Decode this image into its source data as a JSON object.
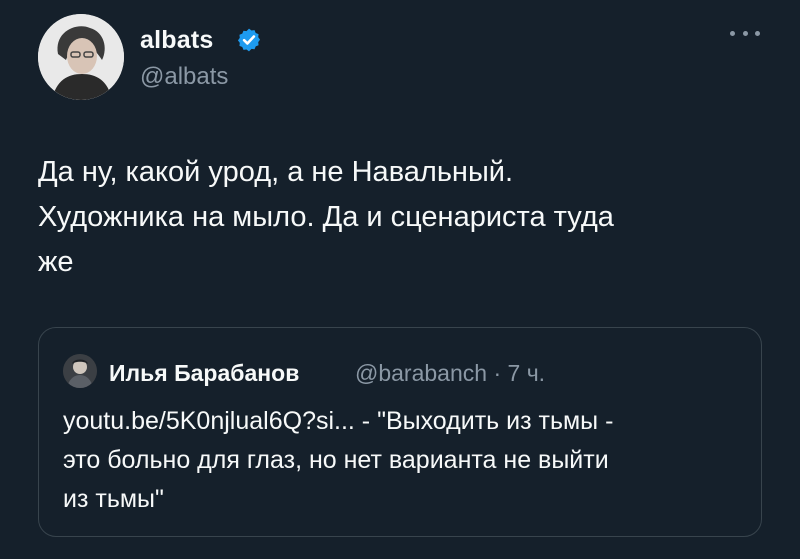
{
  "tweet": {
    "author_name": "albats",
    "author_handle": "@albats",
    "verified_icon": "verified-badge-icon",
    "more_icon": "more-options-icon",
    "text": "Да ну, какой урод, а не Навальный.\nХудожника на мыло. Да и сценариста туда\nже"
  },
  "quote": {
    "author_name": "Илья Барабанов",
    "author_handle": "@barabanch",
    "separator": "·",
    "time": "7 ч.",
    "text": "youtu.be/5K0njlual6Q?si... - \"Выходить из тьмы -\nэто больно для глаз, но нет варианта не выйти\nиз тьмы\""
  },
  "colors": {
    "background": "#15202b",
    "text": "#f7f9f9",
    "muted": "#8b98a5",
    "verified": "#1d9bf0",
    "border": "#38444d"
  }
}
